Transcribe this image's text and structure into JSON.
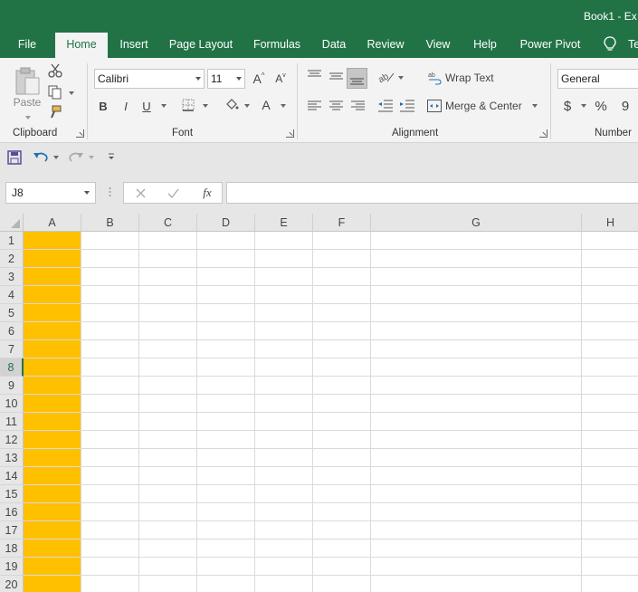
{
  "window": {
    "title": "Book1  -  Ex"
  },
  "tabs": [
    {
      "label": "File"
    },
    {
      "label": "Home"
    },
    {
      "label": "Insert"
    },
    {
      "label": "Page Layout"
    },
    {
      "label": "Formulas"
    },
    {
      "label": "Data"
    },
    {
      "label": "Review"
    },
    {
      "label": "View"
    },
    {
      "label": "Help"
    },
    {
      "label": "Power Pivot"
    },
    {
      "label": "Te"
    }
  ],
  "ribbon": {
    "clipboard": {
      "label": "Clipboard",
      "paste_label": "Paste"
    },
    "font": {
      "label": "Font",
      "font_name": "Calibri",
      "font_size": "11",
      "bold": "B",
      "italic": "I",
      "underline": "U",
      "grow": "A",
      "shrink": "A",
      "font_color": "A"
    },
    "alignment": {
      "label": "Alignment",
      "wrap_text": "Wrap Text",
      "merge_center": "Merge & Center"
    },
    "number": {
      "label": "Number",
      "format": "General",
      "currency": "$",
      "percent": "%",
      "comma": "9"
    }
  },
  "formula_bar": {
    "name_box": "J8",
    "fx": "fx",
    "value": ""
  },
  "grid": {
    "columns": [
      "A",
      "B",
      "C",
      "D",
      "E",
      "F",
      "G",
      "H"
    ],
    "rows": [
      "1",
      "2",
      "3",
      "4",
      "5",
      "6",
      "7",
      "8",
      "9",
      "10",
      "11",
      "12",
      "13",
      "14",
      "15",
      "16",
      "17",
      "18",
      "19",
      "20"
    ],
    "selected_row": "8",
    "fill_color_column_a": "#ffc000"
  },
  "colors": {
    "accent": "#217346",
    "fill": "#ffc000"
  }
}
